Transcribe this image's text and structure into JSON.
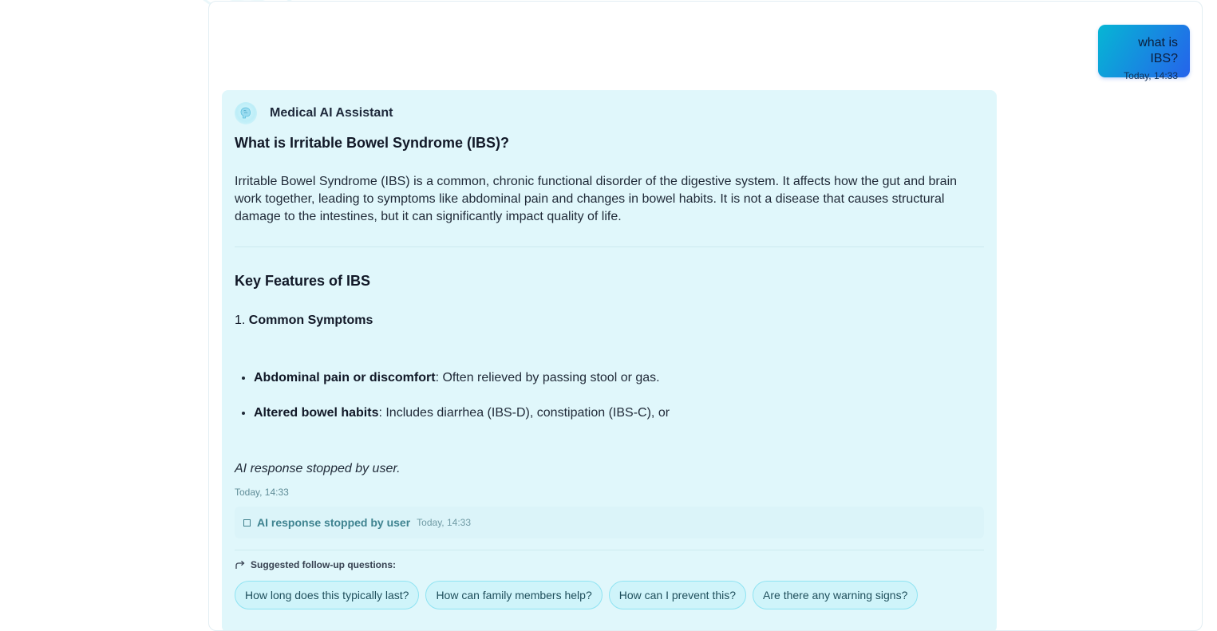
{
  "user_message": {
    "text": "what is IBS?",
    "time": "Today, 14:33"
  },
  "assistant": {
    "name": "Medical AI Assistant",
    "avatar_icon": "brain-icon",
    "title": "What is Irritable Bowel Syndrome (IBS)?",
    "intro": "Irritable Bowel Syndrome (IBS) is a common, chronic functional disorder of the digestive system. It affects how the gut and brain work together, leading to symptoms like abdominal pain and changes in bowel habits. It is not a disease that causes structural damage to the intestines, but it can significantly impact quality of life.",
    "section_title": "Key Features of IBS",
    "numbered_item": {
      "number": "1.",
      "label": "Common Symptoms"
    },
    "bullets": [
      {
        "bold": "Abdominal pain or discomfort",
        "text": ": Often relieved by passing stool or gas."
      },
      {
        "bold": "Altered bowel habits",
        "text": ": Includes diarrhea (IBS-D), constipation (IBS-C), or"
      }
    ],
    "stopped_text": "AI response stopped by user.",
    "stopped_time": "Today, 14:33",
    "status": {
      "icon": "stop-square-icon",
      "label": "AI response stopped by user",
      "time": "Today, 14:33"
    },
    "followup": {
      "icon": "share-arrow-icon",
      "label": "Suggested follow-up questions:",
      "questions": [
        "How long does this typically last?",
        "How can family members help?",
        "How can I prevent this?",
        "Are there any warning signs?"
      ]
    }
  },
  "colors": {
    "user_bubble_start": "#06b6d4",
    "user_bubble_end": "#2563eb",
    "assistant_card_bg": "#e0f7fb",
    "chip_border": "#8fe3f2"
  }
}
